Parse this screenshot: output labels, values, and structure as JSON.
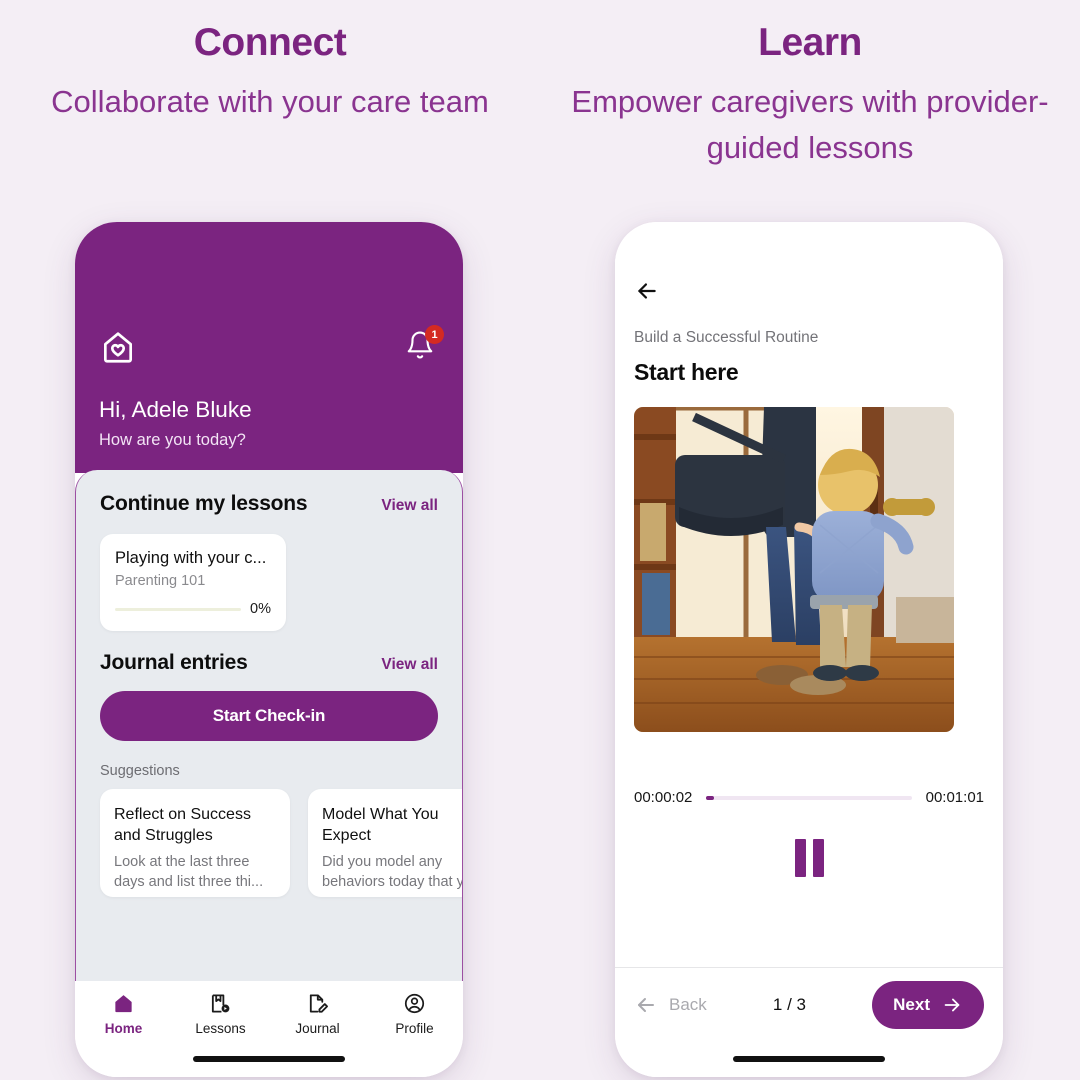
{
  "theme": {
    "brand_purple": "#7B2480",
    "subtitle_purple": "#8A3490",
    "page_background": "#F4EEF5",
    "sheet_background": "#E8EBEF",
    "badge_red": "#D42A22"
  },
  "columns": [
    {
      "title": "Connect",
      "subtitle": "Collaborate with your care team"
    },
    {
      "title": "Learn",
      "subtitle": "Empower caregivers with provider-guided lessons"
    }
  ],
  "home_screen": {
    "logo_icon": "house-heart-logo-icon",
    "notifications": {
      "icon": "bell-icon",
      "count": "1"
    },
    "greeting": "Hi, Adele Bluke",
    "greeting_sub": "How are you today?",
    "lessons_section": {
      "heading": "Continue my lessons",
      "view_all": "View all",
      "card": {
        "title": "Playing with your c...",
        "subtitle": "Parenting 101",
        "progress_label": "0%",
        "progress_value": 0
      }
    },
    "journal_section": {
      "heading": "Journal entries",
      "view_all": "View all",
      "cta_label": "Start Check-in"
    },
    "suggestions": {
      "label": "Suggestions",
      "cards": [
        {
          "title": "Reflect on Success and Struggles",
          "text": "Look at the last three days and list three thi..."
        },
        {
          "title": "Model What You Expect",
          "text": "Did you model any behaviors today that y"
        }
      ]
    },
    "tabs": [
      {
        "label": "Home",
        "icon": "home-icon",
        "active": true
      },
      {
        "label": "Lessons",
        "icon": "lessons-icon",
        "active": false
      },
      {
        "label": "Journal",
        "icon": "journal-icon",
        "active": false
      },
      {
        "label": "Profile",
        "icon": "profile-icon",
        "active": false
      }
    ]
  },
  "lesson_screen": {
    "back_icon": "arrow-left-icon",
    "eyebrow": "Build a Successful Routine",
    "title": "Start here",
    "image_alt": "adult-and-child-at-front-door-photo",
    "player": {
      "current_time": "00:00:02",
      "total_time": "00:01:01",
      "progress_percent": 3,
      "state_icon": "pause-icon"
    },
    "footer": {
      "back_label": "Back",
      "back_icon": "arrow-left-icon",
      "pager": "1 / 3",
      "next_label": "Next",
      "next_icon": "arrow-right-icon"
    }
  }
}
